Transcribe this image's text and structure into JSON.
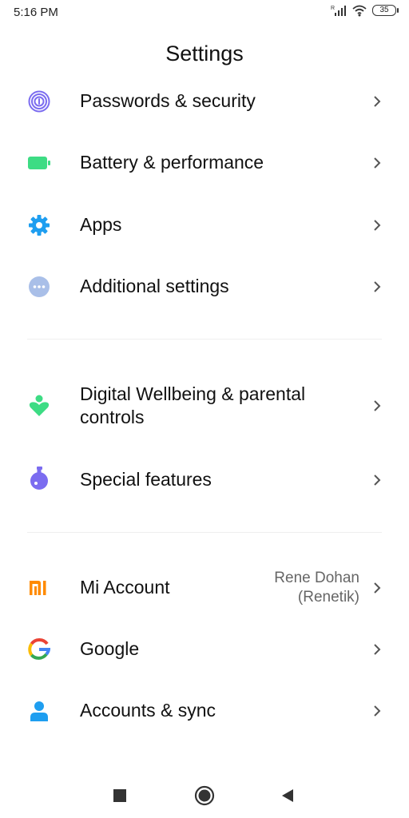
{
  "status_bar": {
    "time": "5:16 PM",
    "battery": "35",
    "icons": [
      "signal-icon",
      "wifi-icon",
      "battery-icon"
    ]
  },
  "header": {
    "title": "Settings"
  },
  "groups": [
    {
      "items": [
        {
          "icon": "fingerprint-icon",
          "color": "#7b6cf0",
          "label": "Passwords & security"
        },
        {
          "icon": "battery-icon",
          "color": "#3ddc84",
          "label": "Battery & performance"
        },
        {
          "icon": "gear-icon",
          "color": "#1e9ef0",
          "label": "Apps"
        },
        {
          "icon": "more-dots-icon",
          "color": "#a9bfe8",
          "label": "Additional settings"
        }
      ]
    },
    {
      "items": [
        {
          "icon": "wellbeing-icon",
          "color": "#3ddc84",
          "label_line1": "Digital Wellbeing & parental",
          "label_line2": "controls"
        },
        {
          "icon": "flask-icon",
          "color": "#7b6cf0",
          "label": "Special features"
        }
      ]
    },
    {
      "items": [
        {
          "icon": "mi-icon",
          "color": "#ff8a00",
          "label": "Mi Account",
          "value_line1": "Rene Dohan",
          "value_line2": "(Renetik)"
        },
        {
          "icon": "google-icon",
          "label": "Google"
        },
        {
          "icon": "user-icon",
          "color": "#1e9ef0",
          "label": "Accounts & sync"
        }
      ]
    }
  ],
  "nav_bar": {
    "buttons": [
      "recents-icon",
      "home-icon",
      "back-icon"
    ]
  }
}
